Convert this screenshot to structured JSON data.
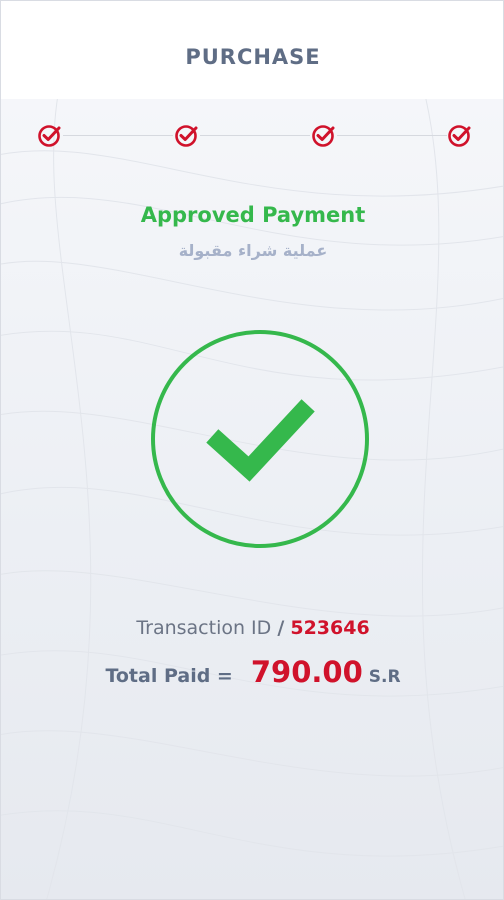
{
  "header": {
    "title": "PURCHASE"
  },
  "stepper": {
    "steps": [
      {
        "state": "complete",
        "icon": "check-circle-icon"
      },
      {
        "state": "complete",
        "icon": "check-circle-icon"
      },
      {
        "state": "complete",
        "icon": "check-circle-icon"
      },
      {
        "state": "complete",
        "icon": "check-circle-icon"
      }
    ],
    "accent_color": "#d0122b"
  },
  "status": {
    "title": "Approved Payment",
    "subtitle": "عملية شراء مقبولة",
    "icon": "check-circle-icon",
    "color": "#35b84c"
  },
  "transaction": {
    "label": "Transaction ID",
    "separator": "/",
    "id": "523646"
  },
  "total": {
    "label": "Total Paid =",
    "amount": "790.00",
    "currency": "S.R"
  }
}
